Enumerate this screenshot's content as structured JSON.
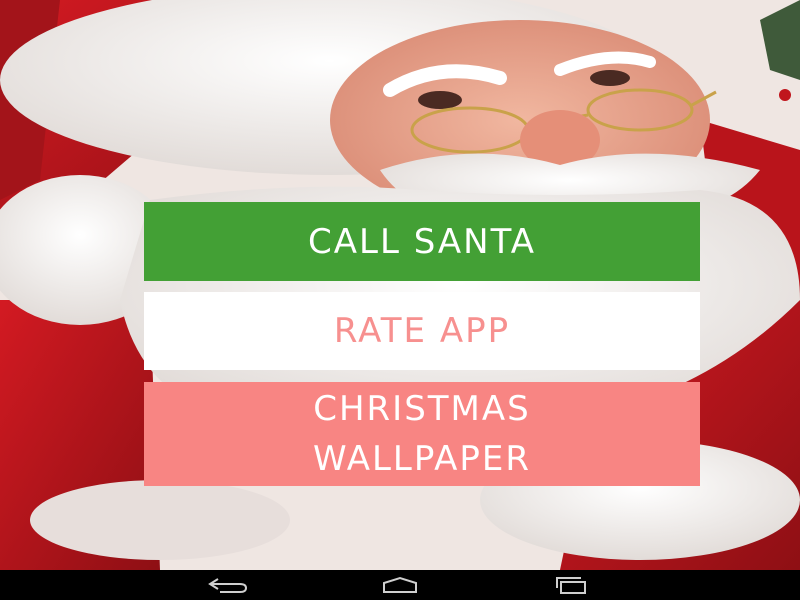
{
  "menu": {
    "call_santa_label": "CALL SANTA",
    "rate_app_label": "RATE APP",
    "wallpaper_line1": "CHRISTMAS",
    "wallpaper_line2": "WALLPAPER"
  },
  "background": {
    "icon": "santa-photo",
    "colors": {
      "suit_red": "#c0151c",
      "fur_white": "#f2f0ee",
      "skin": "#e8a48c"
    }
  },
  "navbar": {
    "back_icon": "back-arrow-icon",
    "home_icon": "home-icon",
    "recent_icon": "recent-apps-icon"
  },
  "colors": {
    "call_button_bg": "#43a035",
    "rate_button_bg": "#ffffff",
    "rate_button_text": "#f7908f",
    "wallpaper_button_bg": "#f88583",
    "navbar_bg": "#000000"
  }
}
